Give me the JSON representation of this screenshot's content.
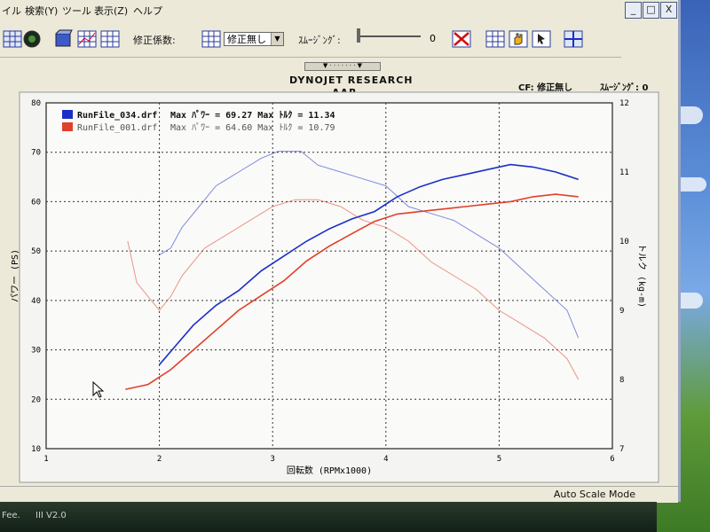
{
  "menu": {
    "items": [
      "イル",
      "検索(Y)",
      "ツール",
      "表示(Z)",
      "ヘルプ"
    ]
  },
  "toolbar": {
    "correction_label": "修正係数:",
    "correction_value": "修正無し",
    "smoothing_label": "ｽﾑｰｼﾞﾝｸﾞ:",
    "smoothing_value": "0"
  },
  "window_buttons": [
    "_",
    "□",
    "X"
  ],
  "report": {
    "company": "DYNOJET  RESEARCH",
    "subtitle": "AAR",
    "cf_label": "CF: 修正無し",
    "smoothing_label": "ｽﾑｰｼﾞﾝｸﾞ: 0"
  },
  "status": {
    "mode": "Auto Scale Mode"
  },
  "taskbar": {
    "line1": "Fee.",
    "line2": "III V2.0"
  },
  "chart_data": {
    "type": "line",
    "xlabel": "回転数 (RPMx1000)",
    "ylabel": "パワー (PS)",
    "y2label": "トルク (kg-m)",
    "xlim": [
      1,
      6
    ],
    "ylim": [
      10,
      80
    ],
    "y2lim": [
      7,
      12
    ],
    "x_ticks": [
      "1",
      "2",
      "3",
      "4",
      "5",
      "6"
    ],
    "y_ticks": [
      "10",
      "20",
      "30",
      "40",
      "50",
      "60",
      "70",
      "80"
    ],
    "y2_ticks": [
      "7",
      "8",
      "9",
      "10",
      "11",
      "12"
    ],
    "grid": true,
    "legend": [
      {
        "name": "RunFile_034.drf",
        "summary": "Max ﾊﾟﾜｰ = 69.27   Max ﾄﾙｸ = 11.34",
        "color": "#1a2fc8"
      },
      {
        "name": "RunFile_001.drf",
        "summary": "Max ﾊﾟﾜｰ = 64.60   Max ﾄﾙｸ = 10.79",
        "color": "#e0402a"
      }
    ],
    "series": [
      {
        "name": "RunFile_034.drf",
        "kind": "power",
        "axis": "left",
        "color": "#1a2fc8",
        "x": [
          2.0,
          2.15,
          2.3,
          2.5,
          2.7,
          2.9,
          3.1,
          3.3,
          3.5,
          3.7,
          3.9,
          4.1,
          4.3,
          4.5,
          4.7,
          4.9,
          5.1,
          5.3,
          5.5,
          5.7
        ],
        "y": [
          27,
          31,
          35,
          39,
          42,
          46,
          49,
          52,
          54.5,
          56.5,
          58,
          61,
          63,
          64.5,
          65.5,
          66.5,
          67.5,
          67,
          66,
          64.5
        ]
      },
      {
        "name": "RunFile_034.drf",
        "kind": "torque",
        "axis": "right",
        "color": "#1a2fc8",
        "x": [
          2.0,
          2.1,
          2.2,
          2.35,
          2.5,
          2.7,
          2.9,
          3.05,
          3.25,
          3.4,
          3.6,
          3.8,
          4.0,
          4.2,
          4.4,
          4.6,
          4.8,
          5.0,
          5.2,
          5.4,
          5.6,
          5.7
        ],
        "y": [
          9.8,
          9.9,
          10.2,
          10.5,
          10.8,
          11.0,
          11.2,
          11.3,
          11.3,
          11.1,
          11.0,
          10.9,
          10.8,
          10.5,
          10.4,
          10.3,
          10.1,
          9.9,
          9.6,
          9.3,
          9.0,
          8.6
        ]
      },
      {
        "name": "RunFile_001.drf",
        "kind": "power",
        "axis": "left",
        "color": "#e0402a",
        "x": [
          1.7,
          1.9,
          2.1,
          2.3,
          2.5,
          2.7,
          2.9,
          3.1,
          3.3,
          3.5,
          3.7,
          3.9,
          4.1,
          4.3,
          4.5,
          4.7,
          4.9,
          5.1,
          5.3,
          5.5,
          5.7
        ],
        "y": [
          22,
          23,
          26,
          30,
          34,
          38,
          41,
          44,
          48,
          51,
          53.5,
          56,
          57.5,
          58,
          58.5,
          59,
          59.5,
          60,
          61,
          61.5,
          61
        ]
      },
      {
        "name": "RunFile_001.drf",
        "kind": "torque",
        "axis": "right",
        "color": "#e0402a",
        "x": [
          1.72,
          1.8,
          1.9,
          2.0,
          2.1,
          2.2,
          2.4,
          2.6,
          2.8,
          3.0,
          3.2,
          3.4,
          3.6,
          3.8,
          4.0,
          4.2,
          4.4,
          4.6,
          4.8,
          5.0,
          5.2,
          5.4,
          5.6,
          5.7
        ],
        "y": [
          10.0,
          9.4,
          9.2,
          9.0,
          9.2,
          9.5,
          9.9,
          10.1,
          10.3,
          10.5,
          10.6,
          10.6,
          10.5,
          10.3,
          10.2,
          10.0,
          9.7,
          9.5,
          9.3,
          9.0,
          8.8,
          8.6,
          8.3,
          8.0
        ]
      }
    ]
  }
}
